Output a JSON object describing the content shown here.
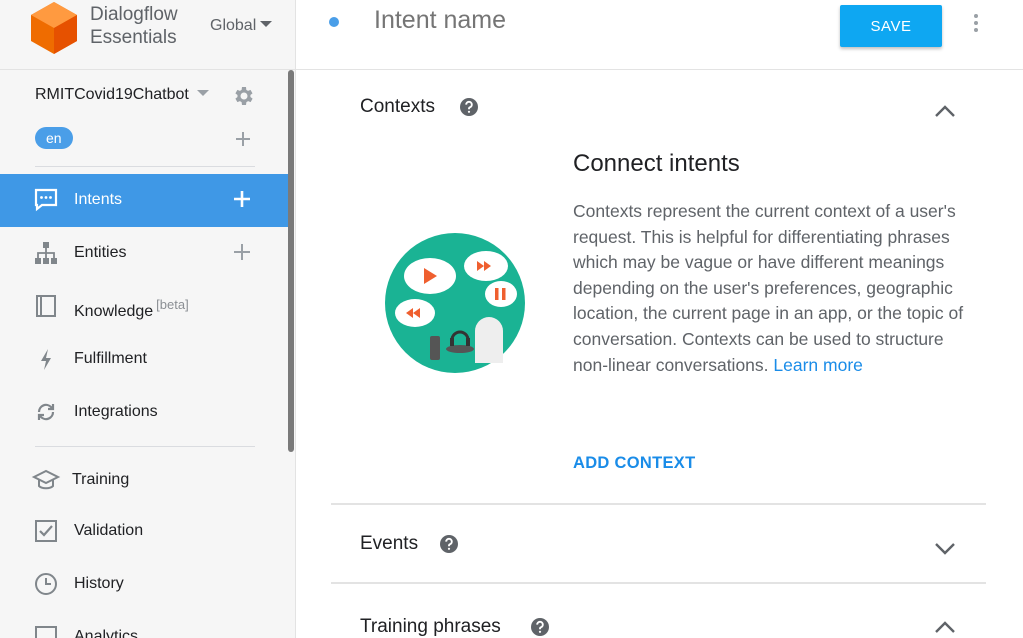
{
  "brand": {
    "line1": "Dialogflow",
    "line2": "Essentials",
    "region": "Global"
  },
  "agent": {
    "name": "RMITCovid19Chatbot",
    "language": "en"
  },
  "nav": [
    {
      "label": "Intents",
      "icon": "chat-icon",
      "has_plus": true,
      "active": true
    },
    {
      "label": "Entities",
      "icon": "hierarchy-icon",
      "has_plus": true,
      "active": false
    },
    {
      "label": "Knowledge",
      "badge": "[beta]",
      "icon": "book-icon",
      "has_plus": false,
      "active": false
    },
    {
      "label": "Fulfillment",
      "icon": "bolt-icon",
      "has_plus": false,
      "active": false
    },
    {
      "label": "Integrations",
      "icon": "sync-icon",
      "has_plus": false,
      "active": false
    },
    {
      "label": "Training",
      "icon": "graduation-cap-icon",
      "has_plus": false,
      "active": false
    },
    {
      "label": "Validation",
      "icon": "checkbox-icon",
      "has_plus": false,
      "active": false
    },
    {
      "label": "History",
      "icon": "clock-icon",
      "has_plus": false,
      "active": false
    },
    {
      "label": "Analytics",
      "icon": "chart-icon",
      "has_plus": false,
      "active": false
    }
  ],
  "topbar": {
    "intent_placeholder": "Intent name",
    "save_label": "SAVE"
  },
  "contexts": {
    "heading": "Contexts",
    "title": "Connect intents",
    "description": "Contexts represent the current context of a user's request. This is helpful for differentiating phrases which may be vague or have different meanings depending on the user's preferences, geographic location, the current page in an app, or the topic of conversation. Contexts can be used to structure non-linear conversations.",
    "learn_more": "Learn more",
    "add_label": "ADD CONTEXT"
  },
  "events": {
    "heading": "Events"
  },
  "training": {
    "heading": "Training phrases"
  },
  "colors": {
    "accent": "#0ea7f2",
    "active_nav": "#3f98e6",
    "link": "#1a8ce8",
    "logo": "#ef6c00",
    "illustration": "#1ab394"
  }
}
